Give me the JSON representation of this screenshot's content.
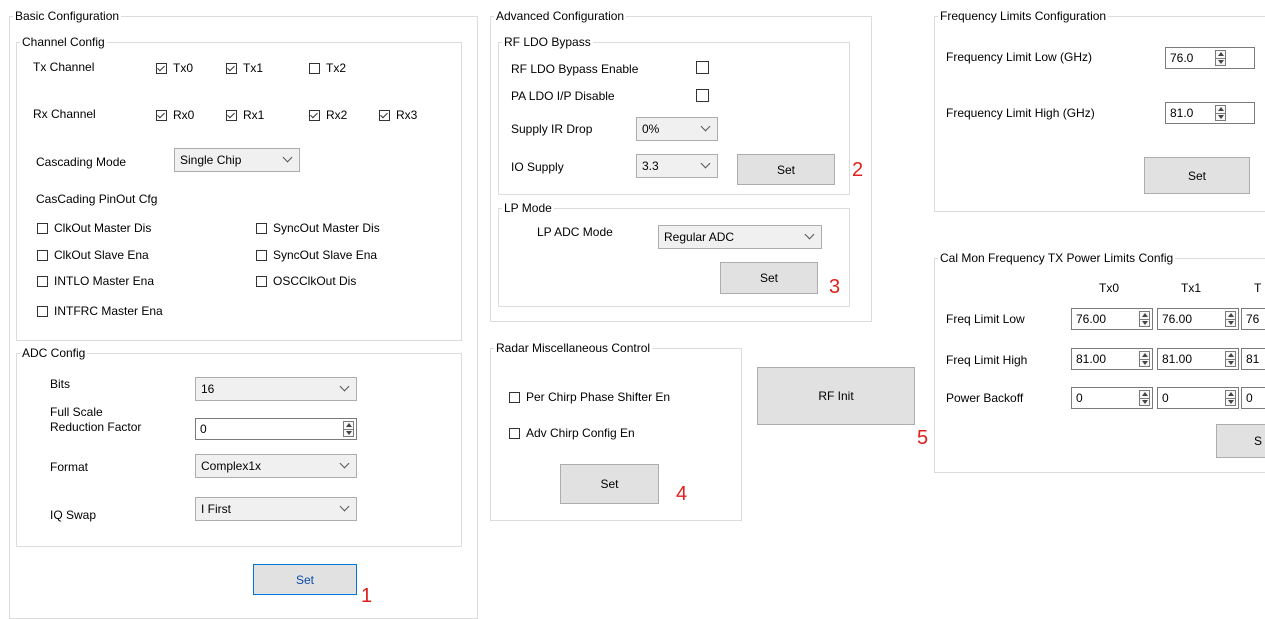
{
  "basic": {
    "legend": "Basic Configuration",
    "channel": {
      "legend": "Channel Config",
      "tx_label": "Tx Channel",
      "tx": [
        {
          "label": "Tx0",
          "checked": true
        },
        {
          "label": "Tx1",
          "checked": true
        },
        {
          "label": "Tx2",
          "checked": false
        }
      ],
      "rx_label": "Rx Channel",
      "rx": [
        {
          "label": "Rx0",
          "checked": true
        },
        {
          "label": "Rx1",
          "checked": true
        },
        {
          "label": "Rx2",
          "checked": true
        },
        {
          "label": "Rx3",
          "checked": true
        }
      ],
      "cascading_mode_label": "Cascading Mode",
      "cascading_mode_value": "Single Chip",
      "pinout_label": "CasCading PinOut Cfg",
      "pinout": [
        {
          "label": "ClkOut Master Dis",
          "checked": false
        },
        {
          "label": "SyncOut Master Dis",
          "checked": false
        },
        {
          "label": "ClkOut Slave Ena",
          "checked": false
        },
        {
          "label": "SyncOut Slave Ena",
          "checked": false
        },
        {
          "label": "INTLO Master Ena",
          "checked": false
        },
        {
          "label": "OSCClkOut Dis",
          "checked": false
        },
        {
          "label": "INTFRC Master Ena",
          "checked": false
        }
      ]
    },
    "adc": {
      "legend": "ADC Config",
      "bits_label": "Bits",
      "bits_value": "16",
      "fsrf_label_1": "Full Scale",
      "fsrf_label_2": "Reduction Factor",
      "fsrf_value": "0",
      "format_label": "Format",
      "format_value": "Complex1x",
      "iq_label": "IQ Swap",
      "iq_value": "I First"
    },
    "set_label": "Set",
    "marker": "1"
  },
  "advanced": {
    "legend": "Advanced Configuration",
    "rfldo": {
      "legend": "RF LDO Bypass",
      "enable_label": "RF LDO Bypass Enable",
      "enable_checked": false,
      "pa_label": "PA LDO I/P Disable",
      "pa_checked": false,
      "ir_label": "Supply IR Drop",
      "ir_value": "0%",
      "io_label": "IO Supply",
      "io_value": "3.3",
      "set_label": "Set",
      "marker": "2"
    },
    "lp": {
      "legend": "LP Mode",
      "adc_label": "LP ADC Mode",
      "adc_value": "Regular ADC",
      "set_label": "Set",
      "marker": "3"
    }
  },
  "radar": {
    "legend": "Radar Miscellaneous Control",
    "phase_label": "Per Chirp Phase Shifter En",
    "phase_checked": false,
    "adv_label": "Adv Chirp Config En",
    "adv_checked": false,
    "set_label": "Set",
    "marker": "4"
  },
  "rf_init": {
    "label": "RF Init",
    "marker": "5"
  },
  "freq_limits": {
    "legend": "Frequency Limits Configuration",
    "low_label": "Frequency Limit Low (GHz)",
    "low_value": "76.0",
    "high_label": "Frequency Limit High (GHz)",
    "high_value": "81.0",
    "set_label": "Set"
  },
  "calmon": {
    "legend": "Cal Mon Frequency TX Power Limits Config",
    "columns": [
      "Tx0",
      "Tx1",
      "T"
    ],
    "rows": [
      {
        "label": "Freq Limit Low",
        "values": [
          "76.00",
          "76.00",
          "76"
        ]
      },
      {
        "label": "Freq Limit High",
        "values": [
          "81.00",
          "81.00",
          "81"
        ]
      },
      {
        "label": "Power Backoff",
        "values": [
          "0",
          "0",
          "0"
        ]
      }
    ],
    "set_label": "S"
  }
}
